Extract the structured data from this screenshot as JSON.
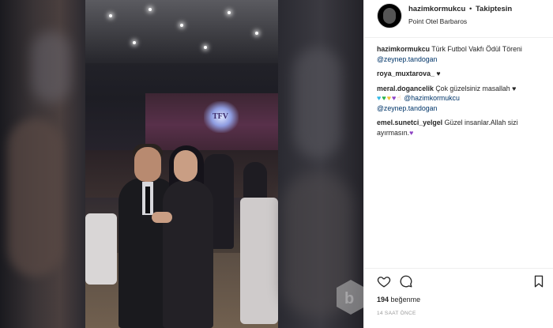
{
  "header": {
    "username": "hazimkormukcu",
    "separator": "•",
    "follow_label": "Takiptesin",
    "location": "Point Otel Barbaros"
  },
  "comments": [
    {
      "user": "hazimkormukcu",
      "text": "Türk Futbol Vakfı Ödül Töreni",
      "mention": "@zeynep.tandogan"
    },
    {
      "user": "roya_muxtarova_",
      "text": "♥"
    },
    {
      "user": "meral.dogancelik",
      "text": "Çok güzelsiniz masallah ♥",
      "emoji_mention": "@hazimkormukcu",
      "mention": "@zeynep.tandogan"
    },
    {
      "user": "emel.sunetci_yelgel",
      "text": "Güzel insanlar.Allah sizi ayırmasın."
    }
  ],
  "actions": {
    "like_icon": "heart-icon",
    "comment_icon": "comment-icon",
    "save_icon": "bookmark-icon"
  },
  "likes": {
    "count": "194",
    "label": "beğenme"
  },
  "time": "14 SAAT ÖNCE",
  "photo": {
    "stage_logo_text": "TFV"
  },
  "colors": {
    "mention": "#003569",
    "panel_bg": "#ffffff",
    "text": "#262626"
  }
}
